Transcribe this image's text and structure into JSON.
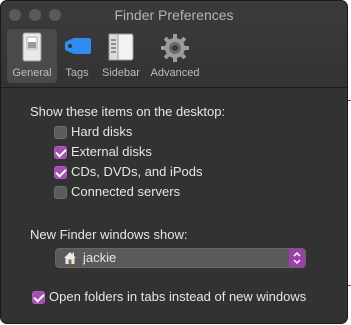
{
  "window": {
    "title": "Finder Preferences"
  },
  "tabs": [
    {
      "label": "General",
      "icon": "switch-icon",
      "active": true
    },
    {
      "label": "Tags",
      "icon": "tag-icon",
      "active": false
    },
    {
      "label": "Sidebar",
      "icon": "sidebar-icon",
      "active": false
    },
    {
      "label": "Advanced",
      "icon": "gear-icon",
      "active": false
    }
  ],
  "desktop": {
    "heading": "Show these items on the desktop:",
    "items": [
      {
        "label": "Hard disks",
        "checked": false
      },
      {
        "label": "External disks",
        "checked": true
      },
      {
        "label": "CDs, DVDs, and iPods",
        "checked": true
      },
      {
        "label": "Connected servers",
        "checked": false
      }
    ]
  },
  "new_window": {
    "heading": "New Finder windows show:",
    "selected": "jackie",
    "icon": "home-icon"
  },
  "open_in_tabs": {
    "label": "Open folders in tabs instead of new windows",
    "checked": true
  },
  "colors": {
    "accent": "#a24fb0",
    "window_bg": "#323232",
    "text": "#e6e6e6"
  }
}
